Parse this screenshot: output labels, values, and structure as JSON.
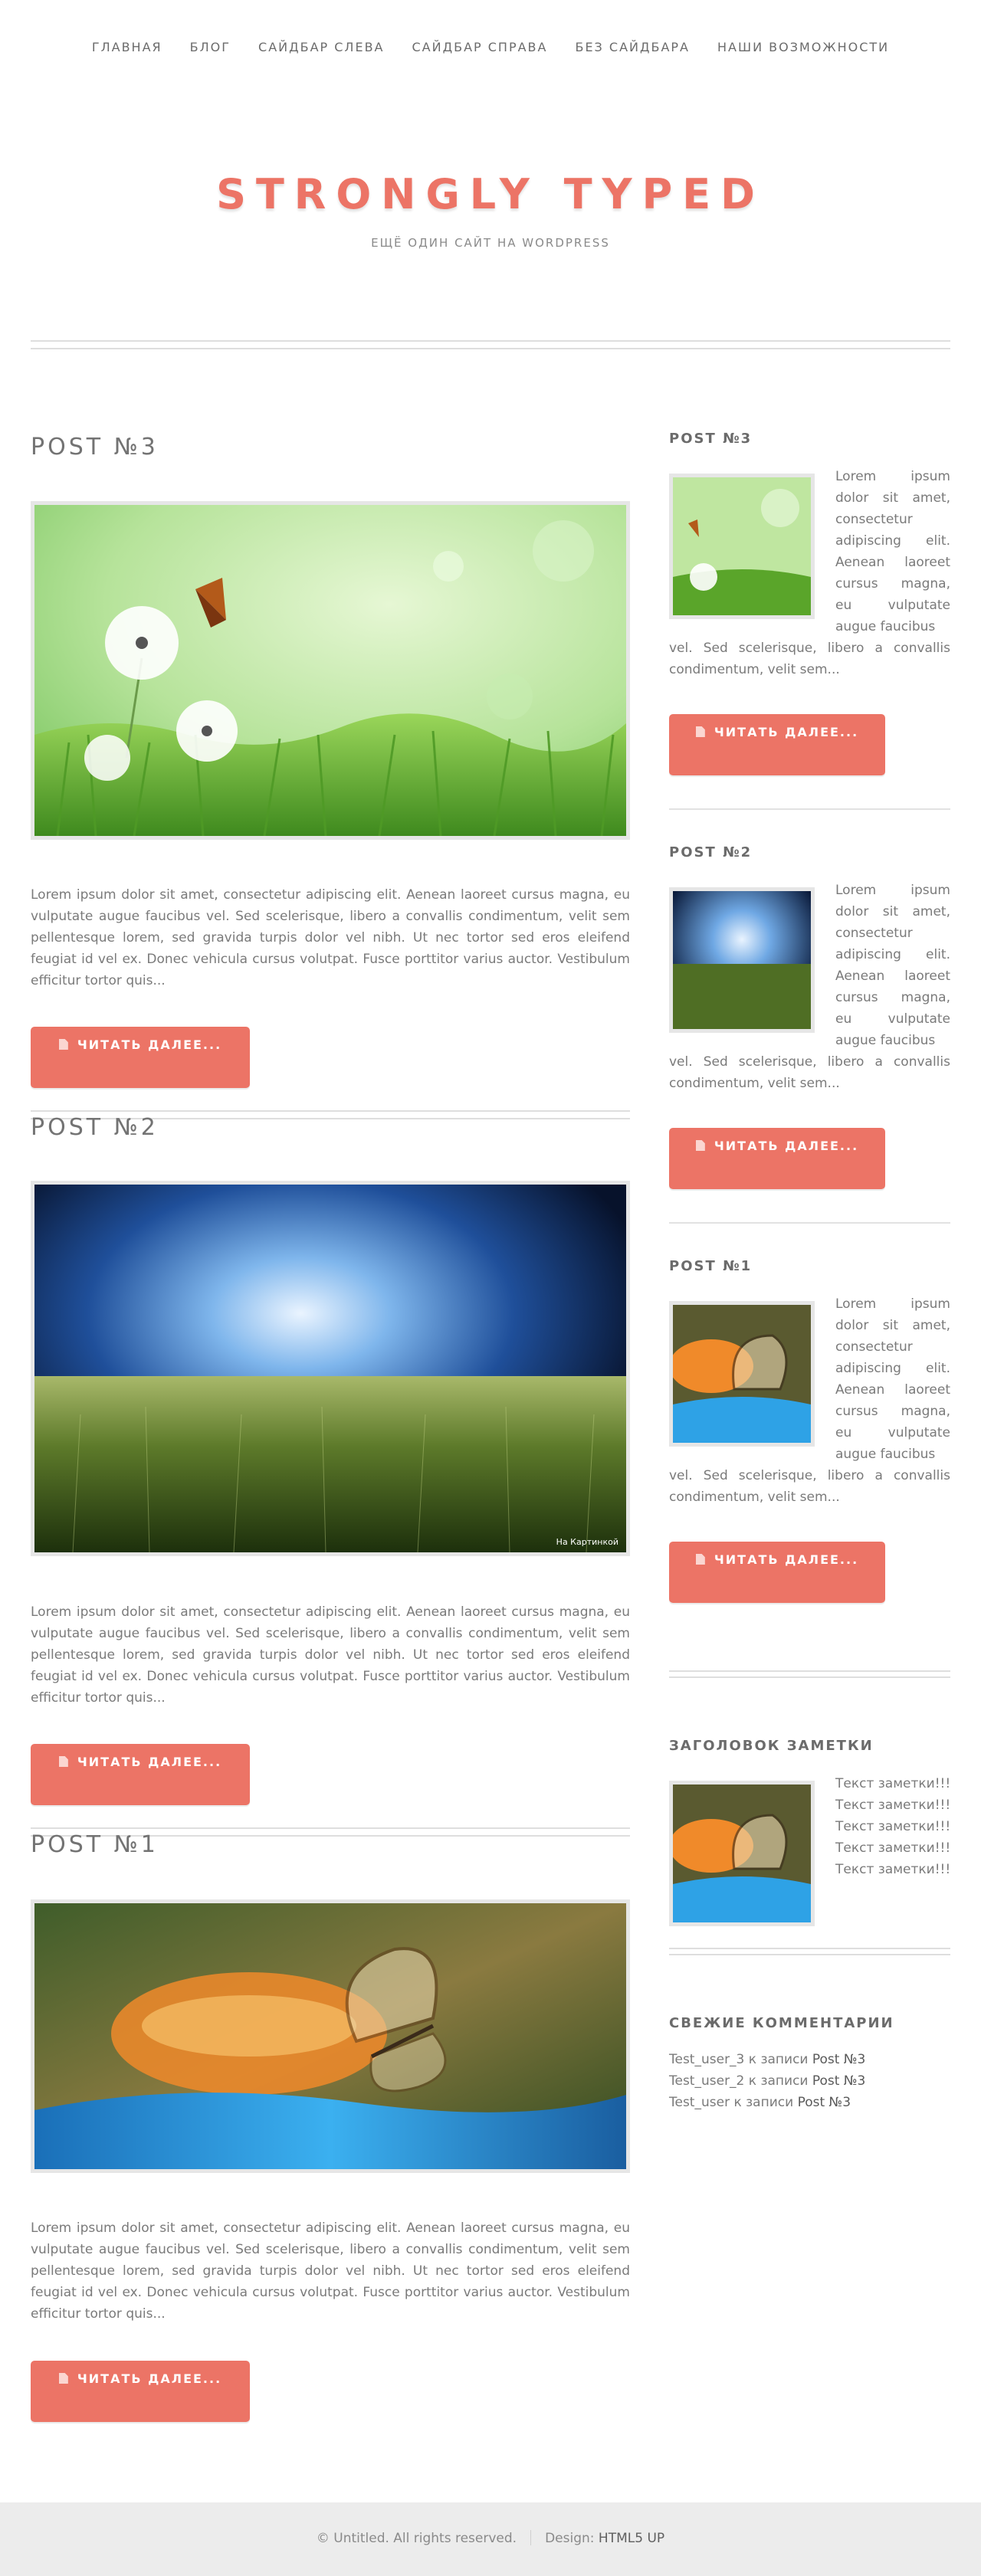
{
  "nav": {
    "items": [
      "ГЛАВНАЯ",
      "БЛОГ",
      "САЙДБАР СЛЕВА",
      "САЙДБАР СПРАВА",
      "БЕЗ САЙДБАРА",
      "НАШИ ВОЗМОЖНОСТИ"
    ]
  },
  "header": {
    "title": "STRONGLY TYPED",
    "tagline": "ЕЩЁ ОДИН САЙТ НА WORDPRESS"
  },
  "posts": [
    {
      "title": "POST №3",
      "image": "dandelion-butterfly-image",
      "excerpt": "Lorem ipsum dolor sit amet, consectetur adipiscing elit. Aenean laoreet cursus magna, eu vulputate augue faucibus vel. Sed scelerisque, libero a convallis condimentum, velit sem pellentesque lorem, sed gravida turpis dolor vel nibh. Ut nec tortor sed eros eleifend feugiat id vel ex. Donec vehicula cursus volutpat. Fusce porttitor varius auctor. Vestibulum efficitur tortor quis...",
      "button": "ЧИТАТЬ ДАЛЕЕ..."
    },
    {
      "title": "POST №2",
      "image": "stormy-field-image",
      "watermark": "На Картинкой",
      "excerpt": "Lorem ipsum dolor sit amet, consectetur adipiscing elit. Aenean laoreet cursus magna, eu vulputate augue faucibus vel. Sed scelerisque, libero a convallis condimentum, velit sem pellentesque lorem, sed gravida turpis dolor vel nibh. Ut nec tortor sed eros eleifend feugiat id vel ex. Donec vehicula cursus volutpat. Fusce porttitor varius auctor. Vestibulum efficitur tortor quis...",
      "button": "ЧИТАТЬ ДАЛЕЕ..."
    },
    {
      "title": "POST №1",
      "image": "glasswing-butterfly-image",
      "excerpt": "Lorem ipsum dolor sit amet, consectetur adipiscing elit. Aenean laoreet cursus magna, eu vulputate augue faucibus vel. Sed scelerisque, libero a convallis condimentum, velit sem pellentesque lorem, sed gravida turpis dolor vel nibh. Ut nec tortor sed eros eleifend feugiat id vel ex. Donec vehicula cursus volutpat. Fusce porttitor varius auctor. Vestibulum efficitur tortor quis...",
      "button": "ЧИТАТЬ ДАЛЕЕ..."
    }
  ],
  "sidebar": {
    "posts": [
      {
        "title": "POST №3",
        "text_side": "Lorem ipsum dolor sit amet, consectetur adipiscing elit. Aenean laoreet cursus magna, eu vulputate augue faucibus",
        "text_below": "vel. Sed scelerisque, libero a convallis condimentum, velit sem...",
        "button": "ЧИТАТЬ ДАЛЕЕ..."
      },
      {
        "title": "POST №2",
        "text_side": "Lorem ipsum dolor sit amet, consectetur adipiscing elit. Aenean laoreet cursus magna, eu vulputate augue faucibus",
        "text_below": "vel. Sed scelerisque, libero a convallis condimentum, velit sem...",
        "button": "ЧИТАТЬ ДАЛЕЕ..."
      },
      {
        "title": "POST №1",
        "text_side": "Lorem ipsum dolor sit amet, consectetur adipiscing elit. Aenean laoreet cursus magna, eu vulputate augue faucibus",
        "text_below": "vel. Sed scelerisque, libero a convallis condimentum, velit sem...",
        "button": "ЧИТАТЬ ДАЛЕЕ..."
      }
    ],
    "note": {
      "title": "ЗАГОЛОВОК ЗАМЕТКИ",
      "lines": [
        "Текст заметки!!!",
        "Текст заметки!!!",
        "Текст заметки!!!",
        "Текст заметки!!!",
        "Текст заметки!!!"
      ]
    },
    "comments": {
      "title": "СВЕЖИЕ КОММЕНТАРИИ",
      "items": [
        {
          "author": "Test_user_3",
          "connector": "к записи",
          "post": "Post №3"
        },
        {
          "author": "Test_user_2",
          "connector": "к записи",
          "post": "Post №3"
        },
        {
          "author": "Test_user",
          "connector": "к записи",
          "post": "Post №3"
        }
      ]
    }
  },
  "footer": {
    "copyright": "© Untitled. All rights reserved.",
    "design_label": "Design:",
    "design_link": "HTML5 UP"
  },
  "colors": {
    "accent": "#ec7466",
    "text": "#7a7a7a",
    "footer_bg": "#ececec"
  }
}
